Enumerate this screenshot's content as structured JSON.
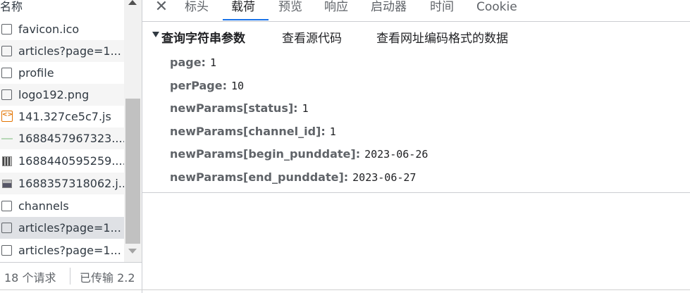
{
  "request_list": {
    "header": "名称",
    "rows": [
      {
        "name": "favicon.ico",
        "icon": "document-icon"
      },
      {
        "name": "articles?page=1...",
        "icon": "document-icon"
      },
      {
        "name": "profile",
        "icon": "document-icon"
      },
      {
        "name": "logo192.png",
        "icon": "document-icon"
      },
      {
        "name": "141.327ce5c7.js",
        "icon": "script-icon"
      },
      {
        "name": "1688457967323....",
        "icon": "image-line-icon"
      },
      {
        "name": "1688440595259....",
        "icon": "image-thumb-icon"
      },
      {
        "name": "1688357318062.j...",
        "icon": "image-thumb-icon"
      },
      {
        "name": "channels",
        "icon": "document-icon"
      },
      {
        "name": "articles?page=1...",
        "icon": "document-icon",
        "selected": true
      },
      {
        "name": "articles?page=1...",
        "icon": "document-icon"
      }
    ]
  },
  "status_bar": {
    "count": "18 个请求",
    "transferred": "已传输 2.2"
  },
  "tabs": [
    "标头",
    "载荷",
    "预览",
    "响应",
    "启动器",
    "时间",
    "Cookie"
  ],
  "active_tab": "载荷",
  "payload": {
    "section_title": "查询字符串参数",
    "view_source": "查看源代码",
    "view_url_encoded": "查看网址编码格式的数据",
    "params": [
      {
        "key": "page:",
        "value": "1"
      },
      {
        "key": "perPage:",
        "value": "10"
      },
      {
        "key": "newParams[status]:",
        "value": "1"
      },
      {
        "key": "newParams[channel_id]:",
        "value": "1"
      },
      {
        "key": "newParams[begin_punddate]:",
        "value": "2023-06-26"
      },
      {
        "key": "newParams[end_punddate]:",
        "value": "2023-06-27"
      }
    ]
  },
  "colors": {
    "accent": "#1a73e8",
    "selected_row": "#dfe1e5",
    "alt_row": "#f5f5f5"
  }
}
